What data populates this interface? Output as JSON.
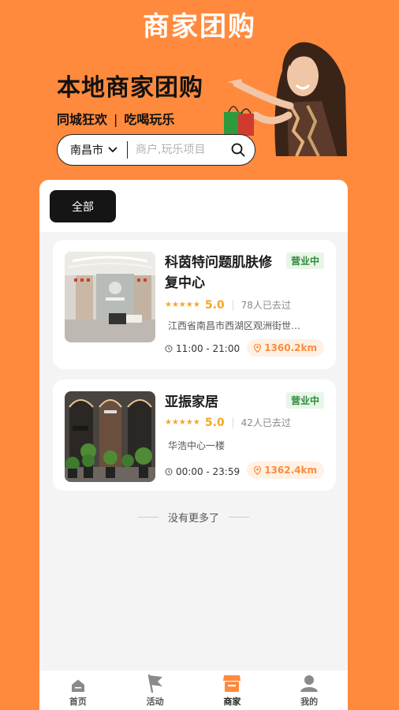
{
  "header": {
    "title": "商家团购"
  },
  "hero": {
    "title": "本地商家团购",
    "subtitle_left": "同城狂欢",
    "subtitle_sep": "|",
    "subtitle_right": "吃喝玩乐"
  },
  "search": {
    "city": "南昌市",
    "placeholder": "商户,玩乐项目"
  },
  "filter": {
    "active_label": "全部"
  },
  "shops": [
    {
      "name": "科茵特问题肌肤修复中心",
      "status": "营业中",
      "stars": "★★★★★",
      "score": "5.0",
      "visited": "78人已去过",
      "address": "江西省南昌市西湖区观洲街世…",
      "hours": "11:00 - 21:00",
      "distance": "1360.2km"
    },
    {
      "name": "亚振家居",
      "status": "营业中",
      "stars": "★★★★★",
      "score": "5.0",
      "visited": "42人已去过",
      "address": "华浩中心一楼",
      "hours": "00:00 - 23:59",
      "distance": "1362.4km"
    }
  ],
  "list_end": "没有更多了",
  "tabbar": {
    "items": [
      {
        "label": "首页",
        "icon": "home-icon"
      },
      {
        "label": "活动",
        "icon": "flag-icon"
      },
      {
        "label": "商家",
        "icon": "store-icon"
      },
      {
        "label": "我的",
        "icon": "user-icon"
      }
    ],
    "active": "商家"
  },
  "colors": {
    "brand": "#ff8a3d",
    "status_green": "#2e8b3a",
    "star": "#f5a623"
  }
}
